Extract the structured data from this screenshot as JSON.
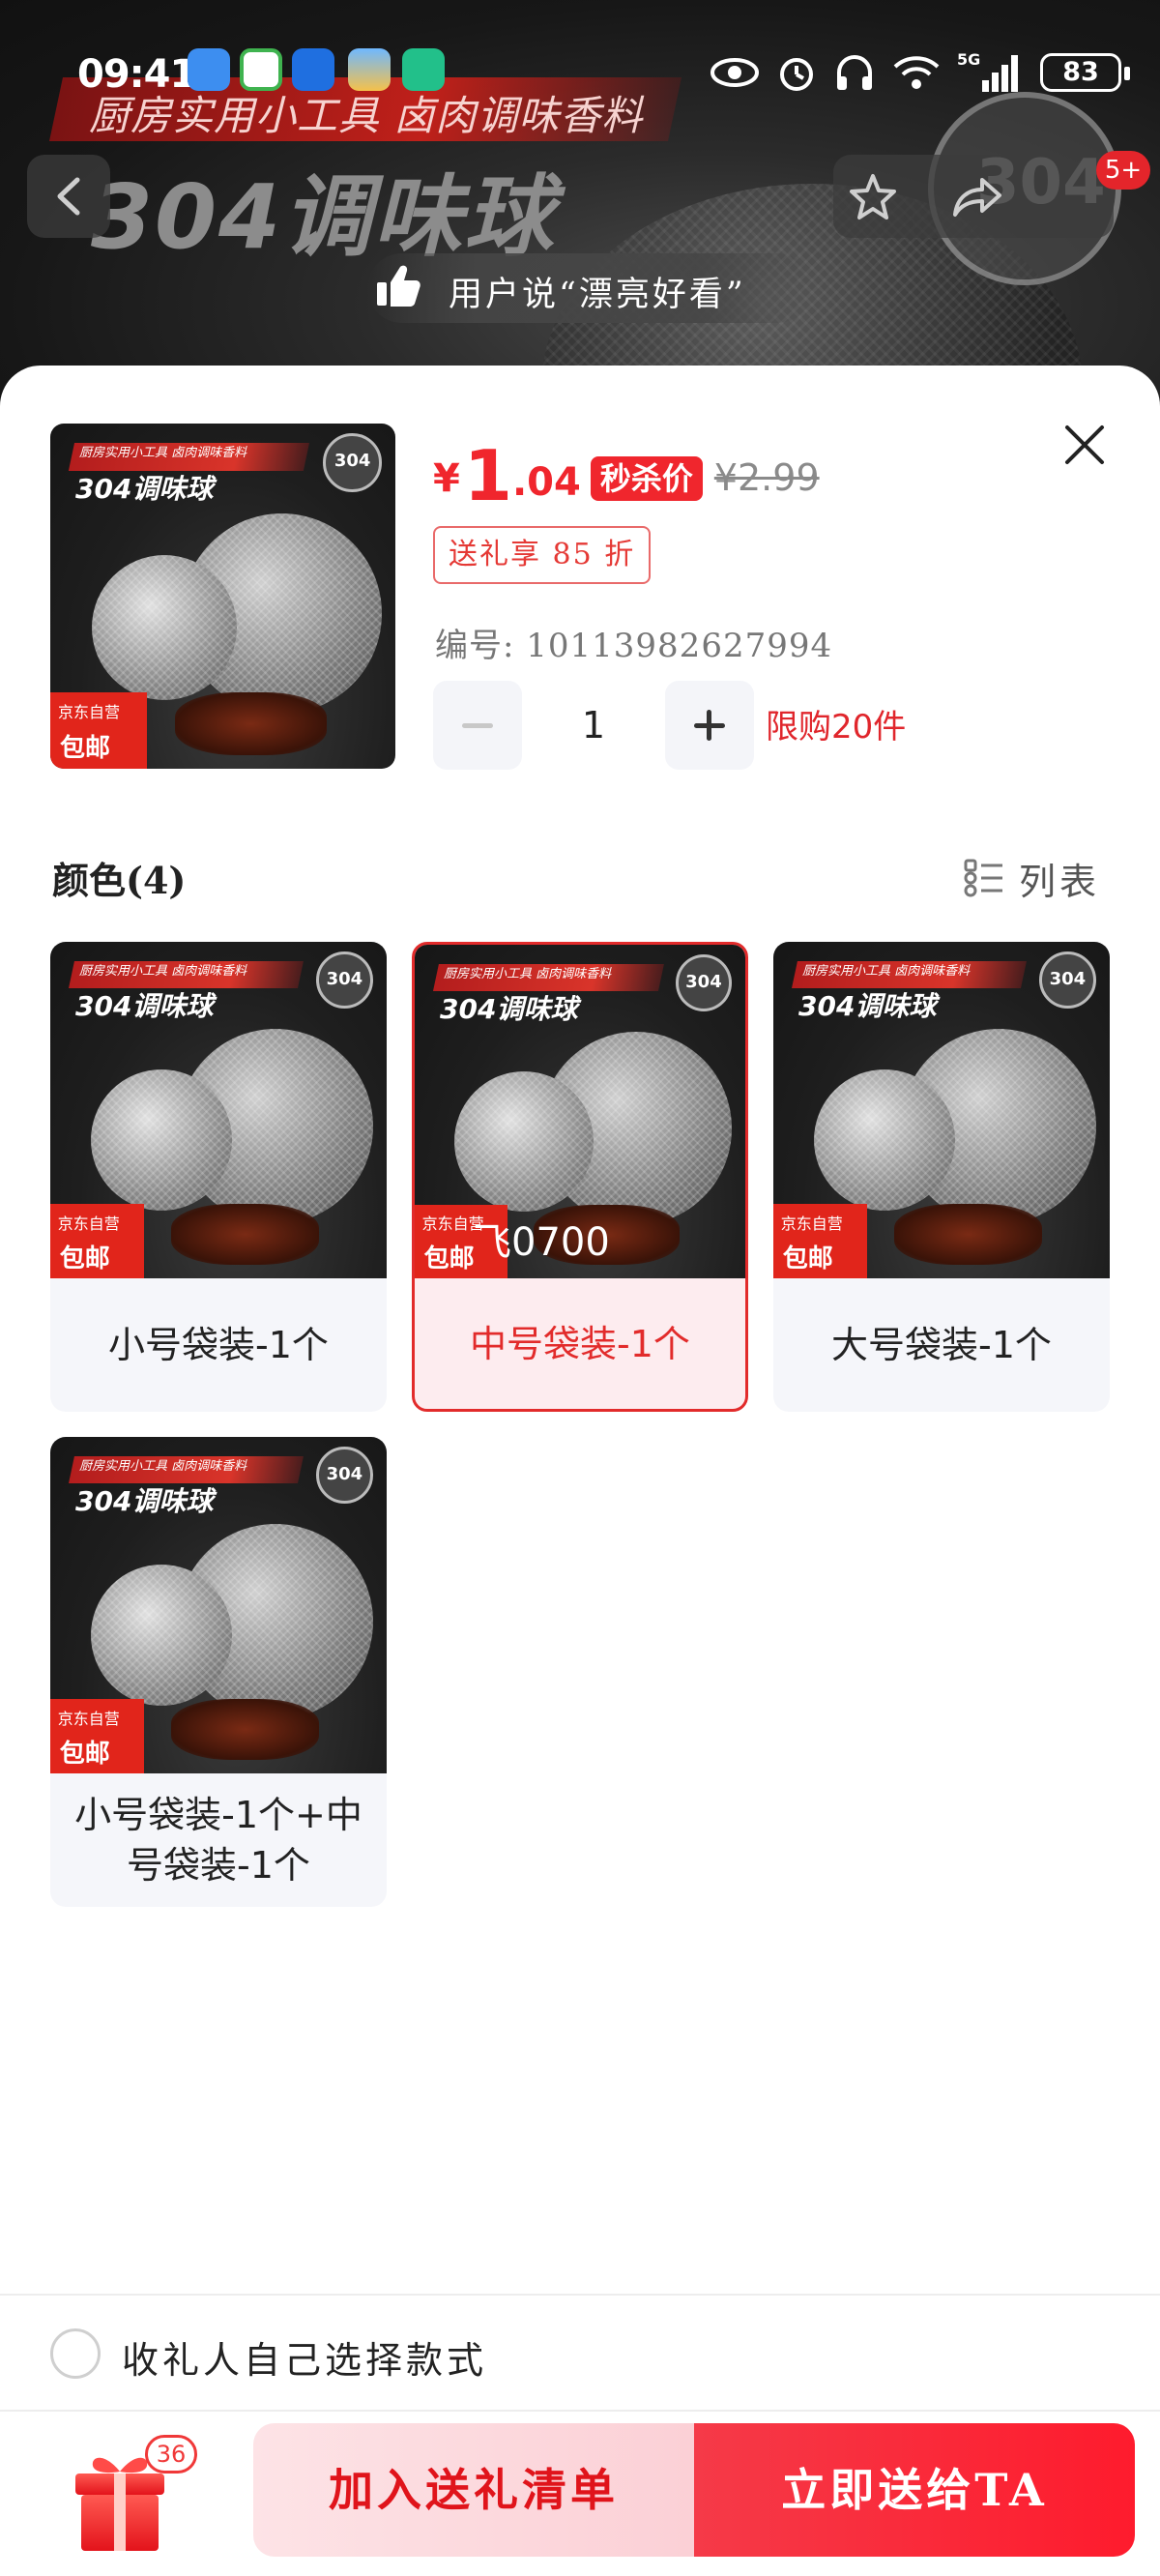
{
  "status_bar": {
    "time": "09:41",
    "app_icons": [
      "message-icon",
      "mobile-icon",
      "smart-home-icon",
      "weather-icon",
      "mi-home-icon"
    ],
    "indicators": [
      "eye-icon",
      "alarm-icon",
      "headphones-icon",
      "wifi-icon",
      "5g-signal-icon"
    ],
    "battery": "83"
  },
  "hero": {
    "banner_text": "厨房实用小工具 卤肉调味香料",
    "title": "304调味球",
    "user_quote": "用户说“漂亮好看”",
    "seal_number": "304",
    "notification_badge": "5+"
  },
  "product": {
    "currency": "¥",
    "price_int": "1",
    "price_dec": ".04",
    "flash_sale_label": "秒杀价",
    "original_price": "¥2.99",
    "gift_discount": "送礼享 85 折",
    "sku_number": "编号: 10113982627994",
    "quantity": "1",
    "purchase_limit": "限购20件",
    "image": {
      "banner": "厨房实用小工具 卤肉调味香料",
      "title": "304调味球",
      "seal": "304",
      "tag_top": "京东自营",
      "tag_bottom": "包邮"
    }
  },
  "variants": {
    "title": "颜色(4)",
    "view_toggle_label": "列表",
    "selected_index": 1,
    "items": [
      {
        "label": "小号袋装-1个"
      },
      {
        "label": "中号袋装-1个"
      },
      {
        "label": "大号袋装-1个"
      },
      {
        "label": "小号袋装-1个+中号袋装-1个"
      }
    ],
    "selected_watermark": "飞0700"
  },
  "recipient_choice": {
    "label": "收礼人自己选择款式",
    "checked": false
  },
  "footer": {
    "gift_count": "36",
    "add_to_list_label": "加入送礼清单",
    "send_now_label": "立即送给TA"
  },
  "colors": {
    "accent_red": "#f0262d",
    "button_red": "#fe1b2d",
    "button_pink": "#fde3e6",
    "card_bg": "#f5f6fa"
  }
}
